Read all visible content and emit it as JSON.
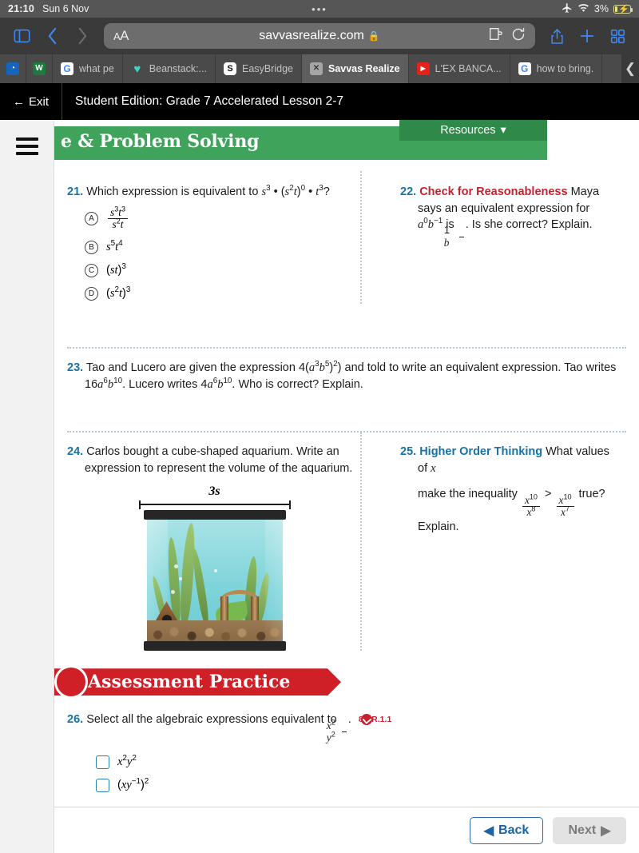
{
  "status_bar": {
    "time": "21:10",
    "date": "Sun 6 Nov",
    "center_dots": "•••",
    "airplane_icon": "airplane-icon",
    "wifi_icon": "wifi-icon",
    "battery_percent": "3%",
    "battery_state": "charging"
  },
  "browser": {
    "sidebar_icon": "sidebar-toggle-icon",
    "back_icon": "back-chevron-icon",
    "forward_icon": "forward-chevron-icon",
    "page_settings_label": "AA",
    "url": "savvasrealize.com",
    "lock_icon": "lock-icon",
    "extensions_icon": "extensions-icon",
    "reload_icon": "reload-icon",
    "share_icon": "share-icon",
    "newtab_icon": "plus-icon",
    "tabs_overview_icon": "tab-grid-icon",
    "tab_overflow_icon": "chevron-right-icon",
    "tabs": [
      {
        "label": "",
        "favicon": "app-icon",
        "active": false,
        "pinned": true
      },
      {
        "label": "",
        "favicon": "w-icon",
        "active": false,
        "pinned": true
      },
      {
        "label": "what pe",
        "favicon": "google-icon",
        "active": false,
        "pinned": false
      },
      {
        "label": "Beanstack:...",
        "favicon": "heart-icon",
        "active": false,
        "pinned": false
      },
      {
        "label": "EasyBridge",
        "favicon": "s-icon",
        "active": false,
        "pinned": false
      },
      {
        "label": "Savvas Realize",
        "favicon": "x-icon",
        "active": true,
        "pinned": false
      },
      {
        "label": "L'EX BANCA...",
        "favicon": "youtube-icon",
        "active": false,
        "pinned": false
      },
      {
        "label": "how to bring.",
        "favicon": "google-icon",
        "active": false,
        "pinned": false
      }
    ]
  },
  "app_bar": {
    "exit_label": "Exit",
    "exit_icon": "arrow-left-icon",
    "title": "Student Edition: Grade 7 Accelerated Lesson 2-7"
  },
  "lesson_header": {
    "hamburger_icon": "hamburger-menu-icon",
    "title": "e & Problem Solving",
    "resources_label": "Resources",
    "resources_caret_icon": "caret-down-icon",
    "green": "#3fa35b"
  },
  "questions": {
    "q21": {
      "number": "21.",
      "prompt_parts": {
        "lead": "Which expression is equivalent to ",
        "tail": "?"
      },
      "choices": [
        {
          "letter": "A",
          "type": "fraction",
          "num": "s³t³",
          "den": "s²t"
        },
        {
          "letter": "B",
          "type": "plain",
          "expr": "s⁵t⁴"
        },
        {
          "letter": "C",
          "type": "plain",
          "expr": "(st)³"
        },
        {
          "letter": "D",
          "type": "plain",
          "expr": "(s²t)³"
        }
      ]
    },
    "q22": {
      "number": "22.",
      "title": "Check for Reasonableness",
      "text_1": " Maya says an equivalent expression for ",
      "text_2": " is ",
      "text_3": ". Is she correct? Explain."
    },
    "q23": {
      "number": "23.",
      "text_1": "Tao and Lucero are given the expression 4(",
      "text_2": ") and told to write an equivalent expression. Tao writes 16",
      "text_3": ". Lucero writes 4",
      "text_4": ". Who is correct? Explain."
    },
    "q24": {
      "number": "24.",
      "text": "Carlos bought a cube-shaped aquarium. Write an expression to represent the volume of the aquarium.",
      "figure": {
        "dimension_label": "3s",
        "alt": "cube-shaped aquarium with plants, gravel and ruins"
      }
    },
    "q25": {
      "number": "25.",
      "title": "Higher Order Thinking",
      "text_1": " What values of ",
      "text_2": " make the inequality ",
      "text_3": " true? Explain.",
      "inequality": {
        "left_num": "x¹⁰",
        "left_den": "x⁸",
        "operator": ">",
        "right_num": "x¹⁰",
        "right_den": "x⁷"
      }
    },
    "q26": {
      "number": "26.",
      "text": "Select all the algebraic expressions equivalent to ",
      "tail": ".",
      "target": {
        "num": "x²",
        "den": "y²"
      },
      "standard_code": "8.AR.1.1",
      "standard_icon": "standard-check-icon",
      "options": [
        {
          "label": "x²y²",
          "checked": false
        },
        {
          "label": "(xy⁻¹)²",
          "checked": false
        }
      ]
    }
  },
  "assessment_banner": {
    "title": "Assessment Practice",
    "color": "#cf2027"
  },
  "footer": {
    "back_label": "Back",
    "back_icon": "triangle-left-icon",
    "next_label": "Next",
    "next_icon": "triangle-right-icon"
  }
}
